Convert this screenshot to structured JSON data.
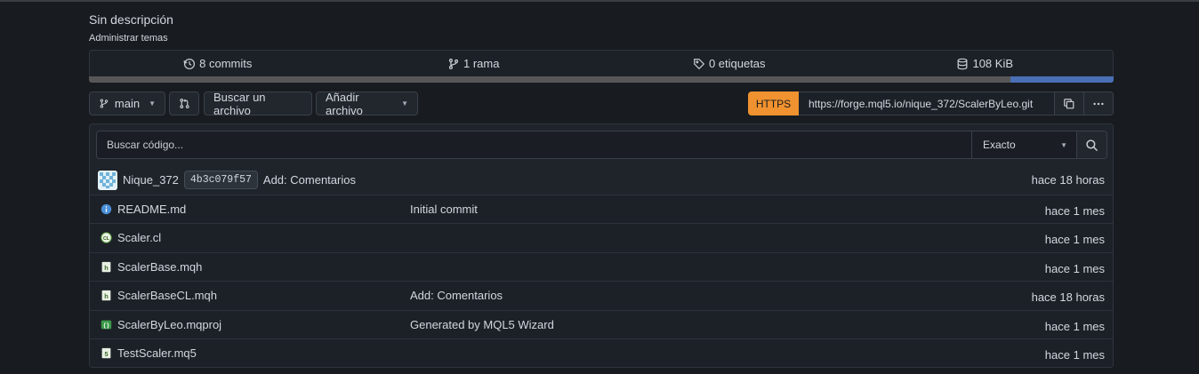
{
  "repo": {
    "description": "Sin descripción",
    "manage_topics": "Administrar temas"
  },
  "stats": {
    "commits": "8 commits",
    "branches": "1 rama",
    "tags": "0 etiquetas",
    "size": "108 KiB"
  },
  "language_bar": {
    "segments": [
      {
        "color": "#575757",
        "fraction": 0.9
      },
      {
        "color": "#4a6fb5",
        "fraction": 0.1
      }
    ]
  },
  "toolbar": {
    "branch": "main",
    "find_file": "Buscar un archivo",
    "add_file": "Añadir archivo"
  },
  "clone": {
    "protocol": "HTTPS",
    "url": "https://forge.mql5.io/nique_372/ScalerByLeo.git"
  },
  "code_search": {
    "placeholder": "Buscar código...",
    "mode": "Exacto"
  },
  "last_commit": {
    "author": "Nique_372",
    "sha": "4b3c079f57",
    "message": "Add: Comentarios",
    "time": "hace 18 horas"
  },
  "files": [
    {
      "name": "README.md",
      "icon": "info-icon",
      "message": "Initial commit",
      "time": "hace 1 mes"
    },
    {
      "name": "Scaler.cl",
      "icon": "cl-file-icon",
      "message": "",
      "time": "hace 1 mes"
    },
    {
      "name": "ScalerBase.mqh",
      "icon": "h-file-icon",
      "message": "",
      "time": "hace 1 mes"
    },
    {
      "name": "ScalerBaseCL.mqh",
      "icon": "h-file-icon",
      "message": "Add: Comentarios",
      "time": "hace 18 horas"
    },
    {
      "name": "ScalerByLeo.mqproj",
      "icon": "json-file-icon",
      "message": "Generated by MQL5 Wizard",
      "time": "hace 1 mes"
    },
    {
      "name": "TestScaler.mq5",
      "icon": "mq5-file-icon",
      "message": "",
      "time": "hace 1 mes"
    }
  ],
  "colors": {
    "background": "#181c21",
    "https_accent": "#f0922f",
    "text": "#d3d7de"
  }
}
